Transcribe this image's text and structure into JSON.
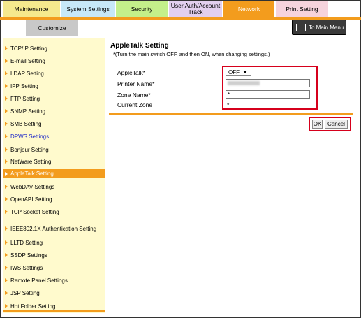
{
  "tabs": [
    {
      "label": "Maintenance",
      "bg": "#f5e98d"
    },
    {
      "label": "System Settings",
      "bg": "#c7e8f8"
    },
    {
      "label": "Security",
      "bg": "#c4f08a"
    },
    {
      "label": "User Auth/Account Track",
      "bg": "#e2cfee"
    },
    {
      "label": "Network",
      "bg": "#f39c1d",
      "active": true
    },
    {
      "label": "Print Setting",
      "bg": "#f6d3dc"
    }
  ],
  "customize_label": "Customize",
  "to_main_label": "To Main Menu",
  "sidebar": {
    "items": [
      {
        "label": "TCP/IP Setting"
      },
      {
        "label": "E-mail Setting"
      },
      {
        "label": "LDAP Setting"
      },
      {
        "label": "IPP Setting"
      },
      {
        "label": "FTP Setting"
      },
      {
        "label": "SNMP Setting"
      },
      {
        "label": "SMB Setting"
      },
      {
        "label": "DPWS Settings",
        "link": true
      },
      {
        "label": "Bonjour Setting"
      },
      {
        "label": "NetWare Setting"
      },
      {
        "label": "AppleTalk Setting",
        "active": true
      },
      {
        "label": "WebDAV Settings"
      },
      {
        "label": "OpenAPI Setting"
      },
      {
        "label": "TCP Socket Setting"
      },
      {
        "label": "IEEE802.1X Authentication Setting"
      },
      {
        "label": "LLTD Setting"
      },
      {
        "label": "SSDP Settings"
      },
      {
        "label": "IWS Settings"
      },
      {
        "label": "Remote Panel Settings"
      },
      {
        "label": "JSP Setting"
      },
      {
        "label": "Hot Folder Setting"
      }
    ]
  },
  "main": {
    "title": "AppleTalk Setting",
    "note": "*(Turn the main switch OFF, and then ON, when changing settings.)",
    "fields": {
      "appletalk_label": "AppleTalk*",
      "appletalk_value": "OFF",
      "printer_name_label": "Printer Name*",
      "zone_name_label": "Zone Name*",
      "zone_name_value": "*",
      "current_zone_label": "Current Zone",
      "current_zone_value": "*"
    },
    "ok_label": "OK",
    "cancel_label": "Cancel"
  },
  "colors": {
    "accent": "#f39c1d",
    "highlight": "#d6001c",
    "sidebar_bg": "#fffacd"
  }
}
